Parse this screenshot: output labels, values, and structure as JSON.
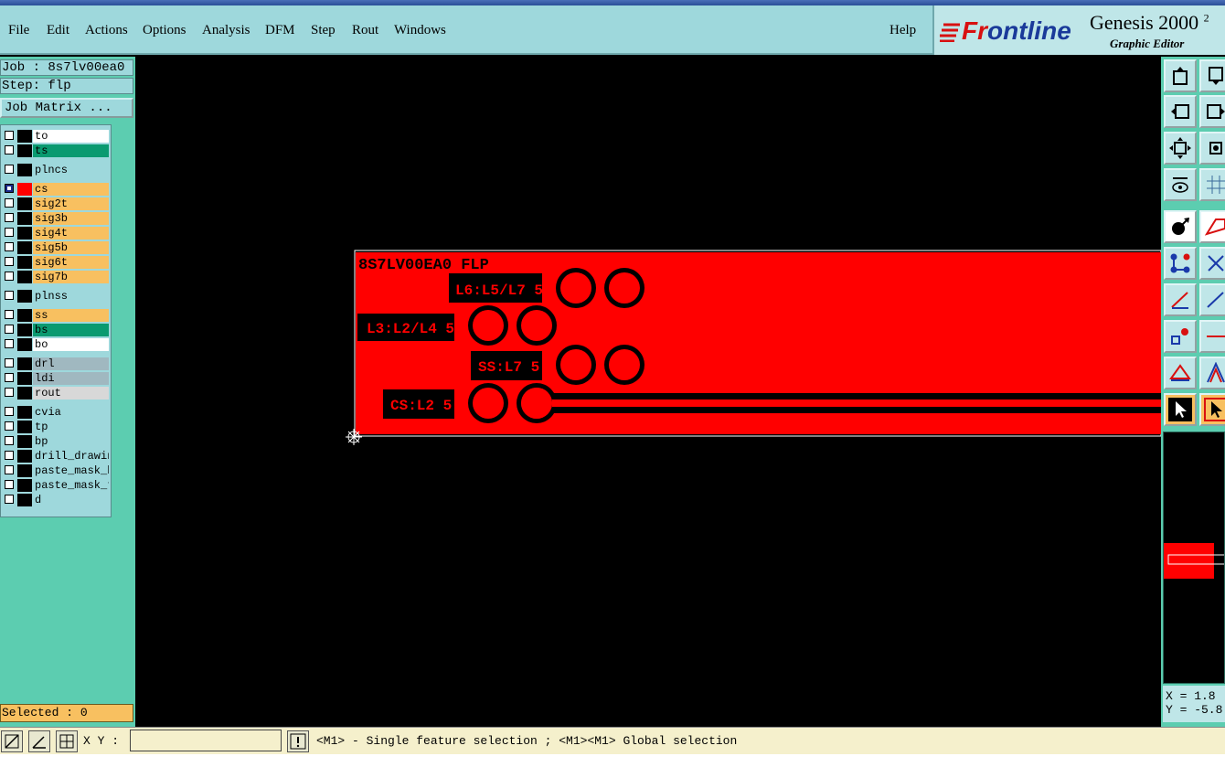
{
  "menu": {
    "items": [
      "File",
      "Edit",
      "Actions",
      "Options",
      "Analysis",
      "DFM",
      "Step",
      "Rout",
      "Windows"
    ],
    "help": "Help"
  },
  "logo": {
    "brand_prefix": "Fr",
    "brand_rest": "ontline",
    "product": "Genesis 2000",
    "product_sup": "2",
    "subtitle": "Graphic Editor"
  },
  "job": {
    "job_label": "Job : 8s7lv00ea0",
    "step_label": "Step: flp",
    "matrix_button": "Job Matrix ..."
  },
  "layers": [
    {
      "name": "to",
      "color": "#ffffff"
    },
    {
      "name": "ts",
      "color": "#0a9a70"
    },
    {
      "name": "plncs",
      "color": "#9ed8dc"
    },
    {
      "name": "cs",
      "color": "#f8c060",
      "active": true
    },
    {
      "name": "sig2t",
      "color": "#f8c060"
    },
    {
      "name": "sig3b",
      "color": "#f8c060"
    },
    {
      "name": "sig4t",
      "color": "#f8c060"
    },
    {
      "name": "sig5b",
      "color": "#f8c060"
    },
    {
      "name": "sig6t",
      "color": "#f8c060"
    },
    {
      "name": "sig7b",
      "color": "#f8c060"
    },
    {
      "name": "plnss",
      "color": "#9ed8dc"
    },
    {
      "name": "ss",
      "color": "#f8c060"
    },
    {
      "name": "bs",
      "color": "#0a9a70"
    },
    {
      "name": "bo",
      "color": "#ffffff"
    },
    {
      "name": "drl",
      "color": "#a0b8c0"
    },
    {
      "name": "ldi",
      "color": "#a0b8c0"
    },
    {
      "name": "rout",
      "color": "#d8d8d8"
    },
    {
      "name": "cvia",
      "color": "#9ed8dc"
    },
    {
      "name": "tp",
      "color": "#9ed8dc"
    },
    {
      "name": "bp",
      "color": "#9ed8dc"
    },
    {
      "name": "drill_drawing",
      "color": "#9ed8dc"
    },
    {
      "name": "paste_mask_b",
      "color": "#9ed8dc"
    },
    {
      "name": "paste_mask_t",
      "color": "#9ed8dc"
    },
    {
      "name": "d",
      "color": "#9ed8dc"
    }
  ],
  "selected": "Selected : 0",
  "board": {
    "title": "8S7LV00EA0 FLP",
    "labels": [
      "L6:L5/L7 5",
      "L3:L2/L4 5",
      "SS:L7 5",
      "CS:L2 5"
    ]
  },
  "readout": {
    "x": "X = 1.8",
    "y": "Y = -5.8"
  },
  "bottom": {
    "xy_label": "X Y :",
    "xy_value": "",
    "hint": "<M1> - Single feature selection ; <M1><M1> Global selection"
  },
  "colors": {
    "copper": "#ff0000",
    "panel": "#5ccdb0",
    "menubar": "#9ed8dc"
  }
}
